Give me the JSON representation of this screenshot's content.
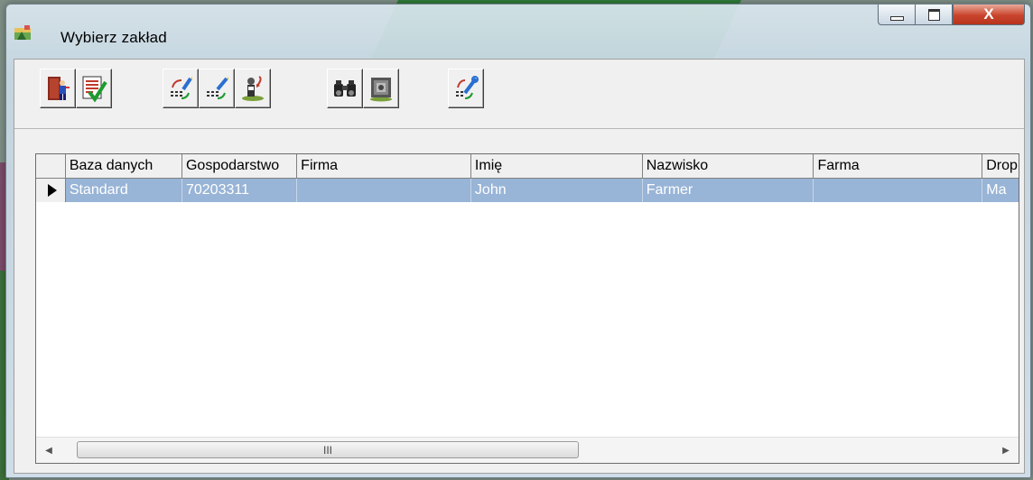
{
  "window": {
    "title": "Wybierz zakład",
    "close_glyph": "X"
  },
  "toolbar": {
    "buttons": [
      {
        "icon": "exit-door-icon"
      },
      {
        "icon": "checklist-icon"
      },
      {
        "icon": "edit-list-icon"
      },
      {
        "icon": "edit-list-alt-icon"
      },
      {
        "icon": "person-undo-icon"
      },
      {
        "icon": "binoculars-icon"
      },
      {
        "icon": "safe-icon"
      },
      {
        "icon": "tools-icon"
      }
    ]
  },
  "grid": {
    "columns": [
      "Baza danych",
      "Gospodarstwo",
      "Firma",
      "Imię",
      "Nazwisko",
      "Farma",
      "Drop"
    ],
    "rows": [
      {
        "cells": [
          "Standard",
          "70203311",
          "",
          "John",
          "Farmer",
          "",
          "Ma"
        ]
      }
    ],
    "selected_row_color": "#98b4d6"
  },
  "scrollbar": {
    "thumb_grip": "III"
  }
}
